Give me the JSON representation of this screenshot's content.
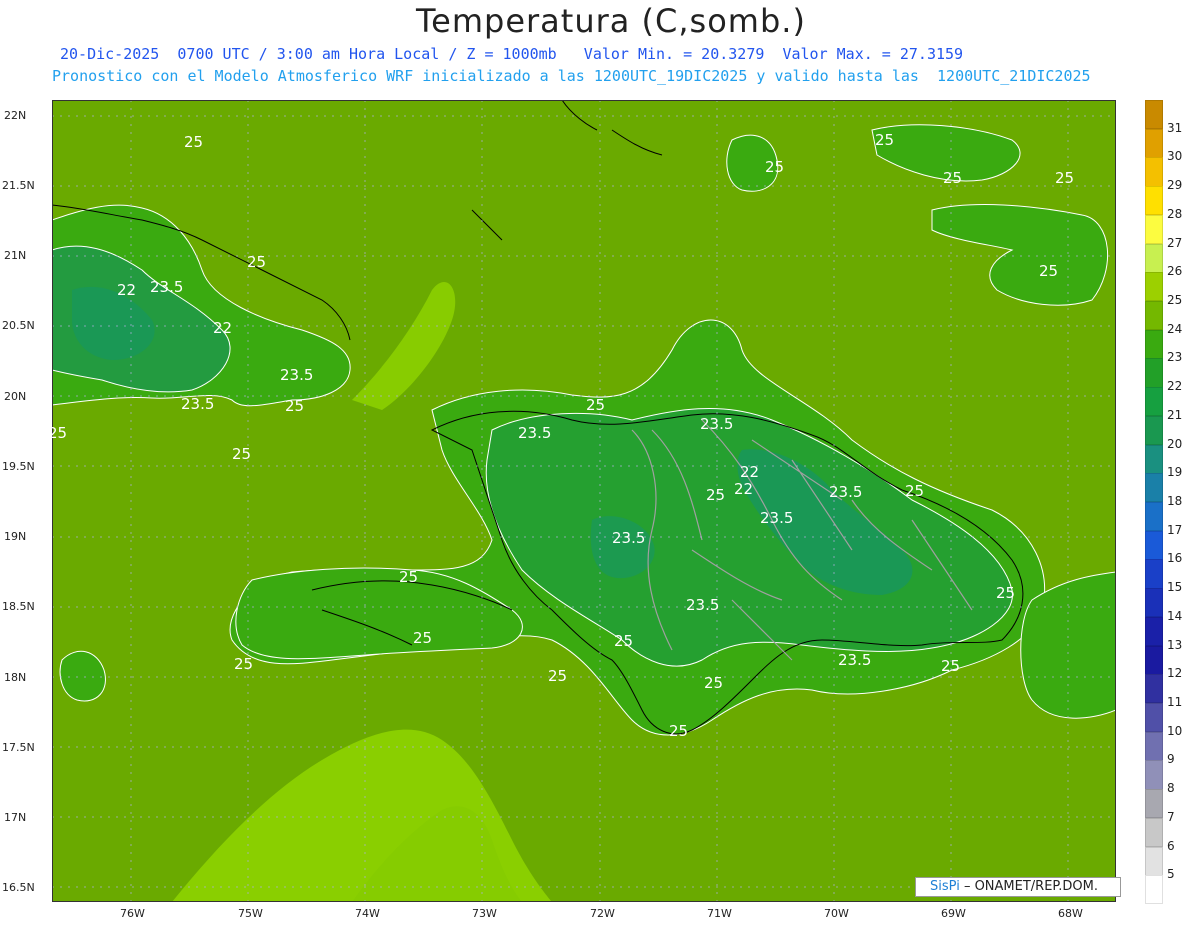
{
  "title": "Temperatura (C,somb.)",
  "subtitle_line1": "20-Dic-2025  0700 UTC / 3:00 am Hora Local / Z = 1000mb   Valor Min. = 20.3279  Valor Max. = 27.3159",
  "subtitle_line2": "Pronostico con el Modelo Atmosferico WRF inicializado a las 1200UTC_19DIC2025 y valido hasta las  1200UTC_21DIC2025",
  "latitude_labels": [
    "22N",
    "21.5N",
    "21N",
    "20.5N",
    "20N",
    "19.5N",
    "19N",
    "18.5N",
    "18N",
    "17.5N",
    "17N",
    "16.5N"
  ],
  "longitude_labels": [
    "76W",
    "75W",
    "74W",
    "73W",
    "72W",
    "71W",
    "70W",
    "69W",
    "68W"
  ],
  "contour_labels": [
    "25",
    "25",
    "25",
    "25",
    "25",
    "22",
    "23.5",
    "22",
    "23.5",
    "23.5",
    "25",
    "25",
    "25",
    "25",
    "23.5",
    "25",
    "23.5",
    "22",
    "22",
    "23.5",
    "25",
    "23.5",
    "25",
    "23.5",
    "25",
    "23.5",
    "25",
    "25",
    "25",
    "25",
    "25",
    "23.5",
    "25",
    "25",
    "25",
    "25"
  ],
  "colorbar": {
    "levels": [
      31,
      30,
      29,
      28,
      27,
      26,
      25,
      24,
      23,
      22,
      21,
      20,
      19,
      18,
      17,
      16,
      15,
      14,
      13,
      12,
      11,
      10,
      9,
      8,
      7,
      6,
      5
    ],
    "colors": [
      "#c98a00",
      "#e0a000",
      "#f4c000",
      "#ffe000",
      "#fcfc40",
      "#c8f050",
      "#9cd000",
      "#74b800",
      "#3aaa10",
      "#22a028",
      "#16a040",
      "#1a9850",
      "#1a9080",
      "#1a80a8",
      "#1a70c8",
      "#1a5ad8",
      "#1a40c8",
      "#1a30b8",
      "#1a20a8",
      "#1a1aa0",
      "#3030a0",
      "#5050a8",
      "#7070b0",
      "#9090b8",
      "#a8a8b0",
      "#c8c8c8",
      "#e2e2e2",
      "#ffffff"
    ]
  },
  "credit": {
    "brand": "SisPi",
    "text": " – ONAMET/REP.DOM."
  },
  "field_colors": {
    "sea": "#6aaa00",
    "warm_band": "#8acf00",
    "land": "#3aaa10",
    "cool_land": "#25a030",
    "coolest": "#1a9855"
  }
}
